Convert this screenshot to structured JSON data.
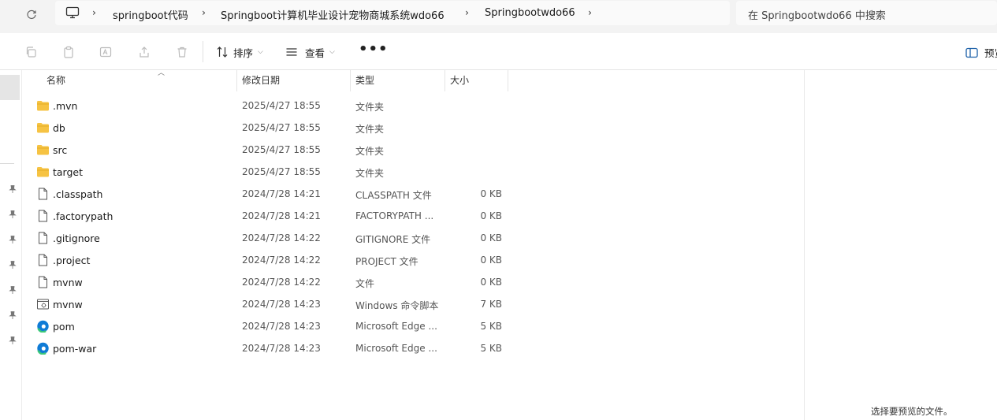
{
  "address_bar": {
    "breadcrumbs": [
      "springboot代码",
      "Springboot计算机毕业设计宠物商城系统wdo66",
      "Springbootwdo66"
    ]
  },
  "search": {
    "placeholder": "在 Springbootwdo66 中搜索"
  },
  "toolbar": {
    "sort_label": "排序",
    "view_label": "查看",
    "more_label": "•••",
    "preview_label": "预览"
  },
  "columns": {
    "name": "名称",
    "modified": "修改日期",
    "type": "类型",
    "size": "大小"
  },
  "files": [
    {
      "name": ".mvn",
      "modified": "2025/4/27 18:55",
      "type": "文件夹",
      "size": "",
      "icon": "folder-icon"
    },
    {
      "name": "db",
      "modified": "2025/4/27 18:55",
      "type": "文件夹",
      "size": "",
      "icon": "folder-icon"
    },
    {
      "name": "src",
      "modified": "2025/4/27 18:55",
      "type": "文件夹",
      "size": "",
      "icon": "folder-icon"
    },
    {
      "name": "target",
      "modified": "2025/4/27 18:55",
      "type": "文件夹",
      "size": "",
      "icon": "folder-icon"
    },
    {
      "name": ".classpath",
      "modified": "2024/7/28 14:21",
      "type": "CLASSPATH 文件",
      "size": "0 KB",
      "icon": "file-icon"
    },
    {
      "name": ".factorypath",
      "modified": "2024/7/28 14:21",
      "type": "FACTORYPATH ...",
      "size": "0 KB",
      "icon": "file-icon"
    },
    {
      "name": ".gitignore",
      "modified": "2024/7/28 14:22",
      "type": "GITIGNORE 文件",
      "size": "0 KB",
      "icon": "file-icon"
    },
    {
      "name": ".project",
      "modified": "2024/7/28 14:22",
      "type": "PROJECT 文件",
      "size": "0 KB",
      "icon": "file-icon"
    },
    {
      "name": "mvnw",
      "modified": "2024/7/28 14:22",
      "type": "文件",
      "size": "0 KB",
      "icon": "file-icon"
    },
    {
      "name": "mvnw",
      "modified": "2024/7/28 14:23",
      "type": "Windows 命令脚本",
      "size": "7 KB",
      "icon": "script-icon"
    },
    {
      "name": "pom",
      "modified": "2024/7/28 14:23",
      "type": "Microsoft Edge ...",
      "size": "5 KB",
      "icon": "edge-icon"
    },
    {
      "name": "pom-war",
      "modified": "2024/7/28 14:23",
      "type": "Microsoft Edge ...",
      "size": "5 KB",
      "icon": "edge-icon"
    }
  ],
  "preview_pane": {
    "message": "选择要预览的文件。"
  },
  "colors": {
    "folder": "#f6c343",
    "edge_blue": "#0f7bd6",
    "edge_green": "#3bc87a"
  }
}
